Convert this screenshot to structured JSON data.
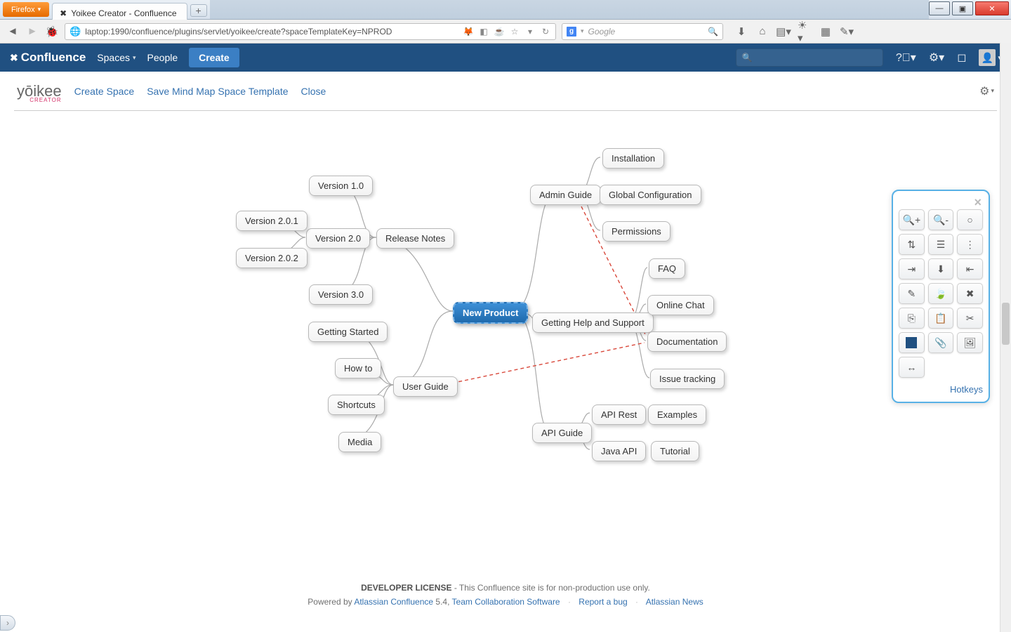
{
  "browser": {
    "name": "Firefox",
    "tab_title": "Yoikee Creator - Confluence",
    "url": "laptop:1990/confluence/plugins/servlet/yoikee/create?spaceTemplateKey=NPROD",
    "search_placeholder": "Google"
  },
  "confluence": {
    "brand": "Confluence",
    "nav": {
      "spaces": "Spaces",
      "people": "People",
      "create": "Create"
    }
  },
  "yoikee": {
    "logo": "yōikee",
    "logo_sub": "CREATOR",
    "links": {
      "create_space": "Create Space",
      "save_template": "Save Mind Map Space Template",
      "close": "Close"
    }
  },
  "mindmap": {
    "root": "New Product",
    "release_notes": "Release Notes",
    "v10": "Version 1.0",
    "v20": "Version 2.0",
    "v201": "Version 2.0.1",
    "v202": "Version 2.0.2",
    "v30": "Version 3.0",
    "user_guide": "User Guide",
    "getting_started": "Getting Started",
    "how_to": "How to",
    "shortcuts": "Shortcuts",
    "media": "Media",
    "admin_guide": "Admin Guide",
    "installation": "Installation",
    "global_config": "Global Configuration",
    "permissions": "Permissions",
    "help_support": "Getting Help and Support",
    "faq": "FAQ",
    "online_chat": "Online Chat",
    "documentation": "Documentation",
    "issue_tracking": "Issue tracking",
    "api_guide": "API Guide",
    "api_rest": "API Rest",
    "java_api": "Java API",
    "examples": "Examples",
    "tutorial": "Tutorial"
  },
  "toolpanel": {
    "hotkeys": "Hotkeys"
  },
  "footer": {
    "license_bold": "DEVELOPER LICENSE",
    "license_rest": " - This Confluence site is for non-production use only.",
    "powered": "Powered by ",
    "acf": "Atlassian Confluence",
    "ver": " 5.4, ",
    "tcs": "Team Collaboration Software",
    "report": "Report a bug",
    "news": "Atlassian News"
  }
}
